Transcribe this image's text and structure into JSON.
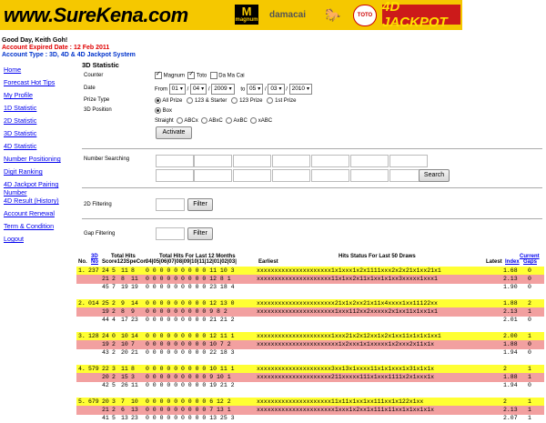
{
  "banner": {
    "site": "www.SureKena.com",
    "magnum_top": "M",
    "magnum_label": "magnum",
    "damacai": "damacai",
    "horse": "🐎",
    "toto": "TOTO",
    "jackpot": "4D JACKPOT"
  },
  "greeting": {
    "hello": "Good Day, Keith Goh!",
    "expired": "Account Expired Date : 12 Feb 2011",
    "type": "Account Type : 3D, 4D & 4D Jackpot System"
  },
  "menu": [
    "Home",
    "Forecast Hot Tips",
    "My Profile",
    "1D Statistic",
    "2D Statistic",
    "3D Statistic",
    "4D Statistic",
    "Number Positioning",
    "Digit Ranking",
    "4D Jackpot Pairing Number",
    "4D Result (History)",
    "Account Renewal",
    "Term & Condition",
    "Logout"
  ],
  "form": {
    "title": "3D Statistic",
    "counter_label": "Counter",
    "magnum": "Magnum",
    "toto": "Toto",
    "damacai": "Da Ma Cai",
    "date_label": "Date",
    "from": "From",
    "to": "to",
    "from_d": "01",
    "from_m": "04",
    "from_y": "2009",
    "to_d": "05",
    "to_m": "03",
    "to_y": "2010",
    "prize_label": "Prize Type",
    "prize_all": "All Prize",
    "prize_123s": "123 & Starter",
    "prize_123": "123 Prize",
    "prize_1": "1st Prize",
    "pos_label": "3D Position",
    "pos_box": "Box",
    "straight": "Straight",
    "abcx": "ABCx",
    "abxc": "ABxC",
    "axbc": "AxBC",
    "xabc": "xABC",
    "activate": "Activate",
    "num_search": "Number Searching",
    "search": "Search",
    "filter2d": "2D Filtering",
    "gapfilter": "Gap Filtering",
    "filter": "Filter",
    "slash": "/"
  },
  "results": {
    "h_3d": "3D",
    "h_no2": "No",
    "h_no": "No.",
    "h_total": "Total Hits",
    "h_score": "Score123SpeCon",
    "h_last12": "Total Hits For Last 12 Months",
    "h_months": "04|05|06|07|08|09|10|11|12|01|02|03|",
    "h_status": "Hits Status For Last 50 Draws",
    "h_earliest": "Earliest",
    "h_latest": "Latest",
    "h_current": "Current",
    "h_gaps": "Gaps",
    "h_index": "Index",
    "groups": [
      {
        "no": "1.",
        "num": "237",
        "rows": [
          [
            "24",
            "5",
            "11",
            "8",
            "0 0 0 0 0 0 0 0 0 11 10 3",
            "xxxxxxxxxxxxxxxxxxxxx1x1xxx1x2x1111xxx2x2x21x1xx21x1",
            "1.68",
            "0"
          ],
          [
            "21",
            "2",
            "8",
            "11",
            "0 0 0 0 0 0 0 0 0 12 8 1",
            "xxxxxxxxxxxxxxxxxxxxx11x1xx2x11x1xx1x1xx3xxxxx1xxx1",
            "2.13",
            "0"
          ],
          [
            "45",
            "7",
            "19",
            "19",
            "0 0 0 0 0 0 0 0 0 23 18 4",
            "",
            "1.90",
            "0"
          ]
        ]
      },
      {
        "no": "2.",
        "num": "014",
        "rows": [
          [
            "25",
            "2",
            "9",
            "14",
            "0 0 0 0 0 0 0 0 0 12 13 0",
            "xxxxxxxxxxxxxxxxxxxxxx21x1x2xx21x11x4xxxx1xx11122xx",
            "1.88",
            "2"
          ],
          [
            "19",
            "2",
            "8",
            "9",
            "0 0 0 0 0 0 0 0 0 9 8 2",
            "xxxxxxxxxxxxxxxxxxxxxx1xxx112xx2xxxxx2x1xx11x1xx1x1",
            "2.13",
            "1"
          ],
          [
            "44",
            "4",
            "17",
            "23",
            "0 0 0 0 0 0 0 0 0 21 21 2",
            "",
            "2.01",
            "0"
          ]
        ]
      },
      {
        "no": "3.",
        "num": "128",
        "rows": [
          [
            "24",
            "0",
            "10",
            "14",
            "0 0 0 0 0 0 0 0 0 12 11 1",
            "xxxxxxxxxxxxxxxxxxxxx1xxx21x2x12xx1x2x1xx11x1x1x1xx1",
            "2.00",
            "1"
          ],
          [
            "19",
            "2",
            "10",
            "7",
            "0 0 0 0 0 0 0 0 0 10 7 2",
            "xxxxxxxxxxxxxxxxxxxxxxx1x2xxx1x1xxxxx1x2xxx2x11x1x",
            "1.88",
            "0"
          ],
          [
            "43",
            "2",
            "20",
            "21",
            "0 0 0 0 0 0 0 0 0 22 18 3",
            "",
            "1.94",
            "0"
          ]
        ]
      },
      {
        "no": "4.",
        "num": "579",
        "rows": [
          [
            "22",
            "3",
            "11",
            "8",
            "0 0 0 0 0 0 0 0 0 10 11 1",
            "xxxxxxxxxxxxxxxxxxxxx3xx13x1xxxx11x1x1xxx1x31x1x1x",
            "2",
            "1"
          ],
          [
            "20",
            "2",
            "15",
            "3",
            "0 0 0 0 0 0 0 0 0 9 10 1",
            "xxxxxxxxxxxxxxxxxxxxx211xxxxx111x1xxx1111x2x1xxx1x",
            "1.88",
            "1"
          ],
          [
            "42",
            "5",
            "26",
            "11",
            "0 0 0 0 0 0 0 0 0 19 21 2",
            "",
            "1.94",
            "0"
          ]
        ]
      },
      {
        "no": "5.",
        "num": "679",
        "rows": [
          [
            "20",
            "3",
            "7",
            "10",
            "0 0 0 0 0 0 0 0 0 6 12 2",
            "xxxxxxxxxxxxxxxxxxxxx11x11x1xx1xx111xx1x122x1xx",
            "2",
            "1"
          ],
          [
            "21",
            "2",
            "6",
            "13",
            "0 0 0 0 0 0 0 0 0 7 13 1",
            "xxxxxxxxxxxxxxxxxxxxxx1xxx1x2xx1x111x11xx1x1xx1x1x",
            "2.13",
            "1"
          ],
          [
            "41",
            "5",
            "13",
            "23",
            "0 0 0 0 0 0 0 0 0 13 25 3",
            "",
            "2.07",
            "1"
          ]
        ]
      }
    ]
  }
}
